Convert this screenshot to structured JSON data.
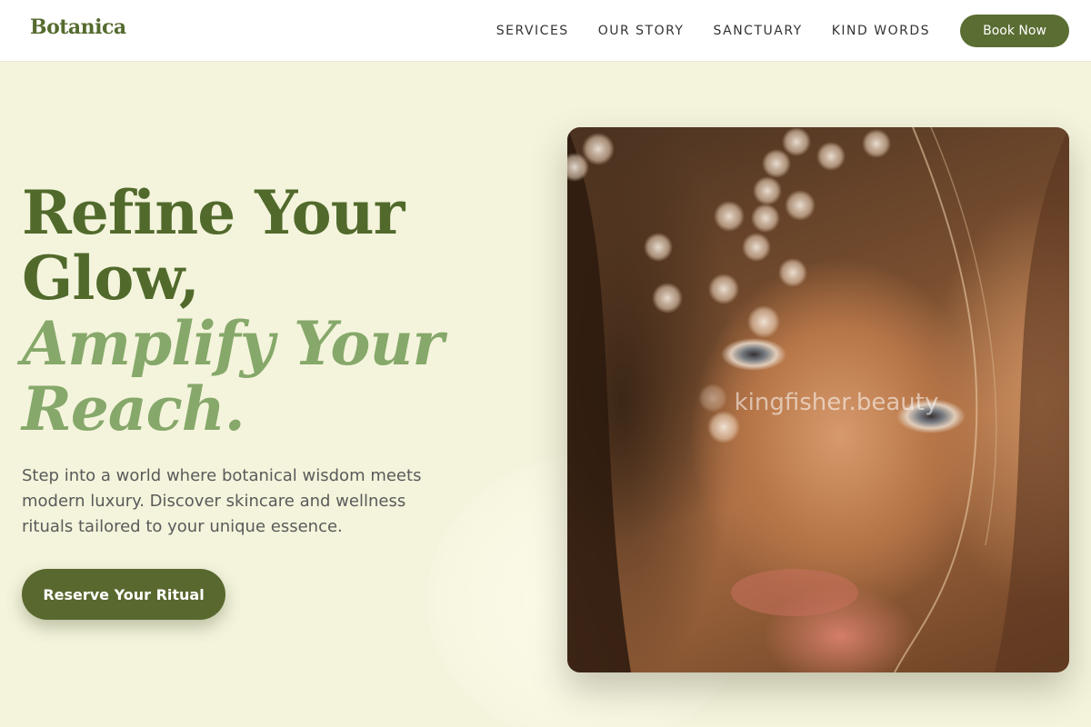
{
  "header": {
    "brand": "Botanica",
    "nav": [
      "SERVICES",
      "OUR STORY",
      "SANCTUARY",
      "KIND WORDS"
    ],
    "book_label": "Book Now"
  },
  "hero": {
    "title_line1": "Refine Your",
    "title_line2": "Glow,",
    "title_accent1": "Amplify Your",
    "title_accent2": "Reach.",
    "description": "Step into a world where botanical wisdom meets modern luxury. Discover skincare and wellness rituals tailored to your unique essence.",
    "cta_label": "Reserve Your Ritual"
  },
  "image": {
    "watermark": "kingfisher.beauty"
  },
  "colors": {
    "brand_green": "#556b2f",
    "accent_green": "#86a86a",
    "page_background": "#f4f4dc"
  }
}
